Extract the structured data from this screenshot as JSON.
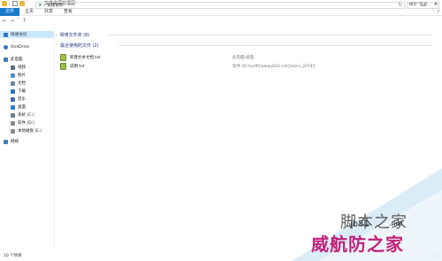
{
  "window": {
    "title": "文件资源管理器",
    "controls": {
      "minimize": "—",
      "maximize": "□",
      "close": "✕"
    },
    "qat_separator": "|"
  },
  "ribbon": {
    "tabs": [
      "文件",
      "主页",
      "共享",
      "查看"
    ],
    "expand_icon": "ˇ",
    "help_icon": "?"
  },
  "addressbar": {
    "back": "←",
    "forward": "→",
    "dropdown": "ˇ",
    "up": "↑",
    "path_separator": "›",
    "location": "快速访问",
    "refresh": "↻",
    "search_placeholder": "搜索\"快速...",
    "search_icon": "⌕"
  },
  "sidebar": {
    "items": [
      {
        "label": "快速访问",
        "icon": "star-icon",
        "color": "#2b78d0"
      },
      {
        "label": "OneDrive",
        "icon": "cloud-icon",
        "color": "#2b78d0"
      },
      {
        "label": "此电脑",
        "icon": "computer-icon",
        "color": "#3c7fbd"
      },
      {
        "label": "视频",
        "icon": "video-icon",
        "color": "#566f87"
      },
      {
        "label": "图片",
        "icon": "picture-icon",
        "color": "#4b8fcc"
      },
      {
        "label": "文档",
        "icon": "document-icon",
        "color": "#6b87a6"
      },
      {
        "label": "下载",
        "icon": "download-icon",
        "color": "#2a72c2"
      },
      {
        "label": "音乐",
        "icon": "music-icon",
        "color": "#3b6ea5"
      },
      {
        "label": "桌面",
        "icon": "desktop-icon",
        "color": "#2d7ad6"
      },
      {
        "label": "系统 (C:)",
        "icon": "drive-icon",
        "color": "#6b7b8c"
      },
      {
        "label": "软件 (D:)",
        "icon": "drive-icon",
        "color": "#8a8a8a"
      },
      {
        "label": "本地磁盘 (E:)",
        "icon": "drive-icon",
        "color": "#8a8a8a"
      },
      {
        "label": "网络",
        "icon": "network-icon",
        "color": "#3b7fc4"
      }
    ]
  },
  "main": {
    "groups": [
      {
        "title": "常用文件夹 (8)",
        "collapsed": true
      },
      {
        "title": "最近使用的文件 (2)",
        "collapsed": false
      }
    ],
    "recent_files": [
      {
        "name": "新建文本文档.txt",
        "path": "此电脑\\桌面"
      },
      {
        "name": "说明.txt",
        "path": "软件 (D:)\\soft\\[www.jb51.net]\\eloni_20745"
      }
    ]
  },
  "statusbar": {
    "item_count": "10 个项目"
  },
  "watermark": {
    "brand_cn": "脚本之家",
    "site": "jb51",
    "tld": ".net",
    "slogan": "威航防之家"
  },
  "colors": {
    "accent": "#1979ca",
    "selection": "#cce8ff",
    "group_title": "#1e3287",
    "watermark_pink": "#c2217a"
  }
}
